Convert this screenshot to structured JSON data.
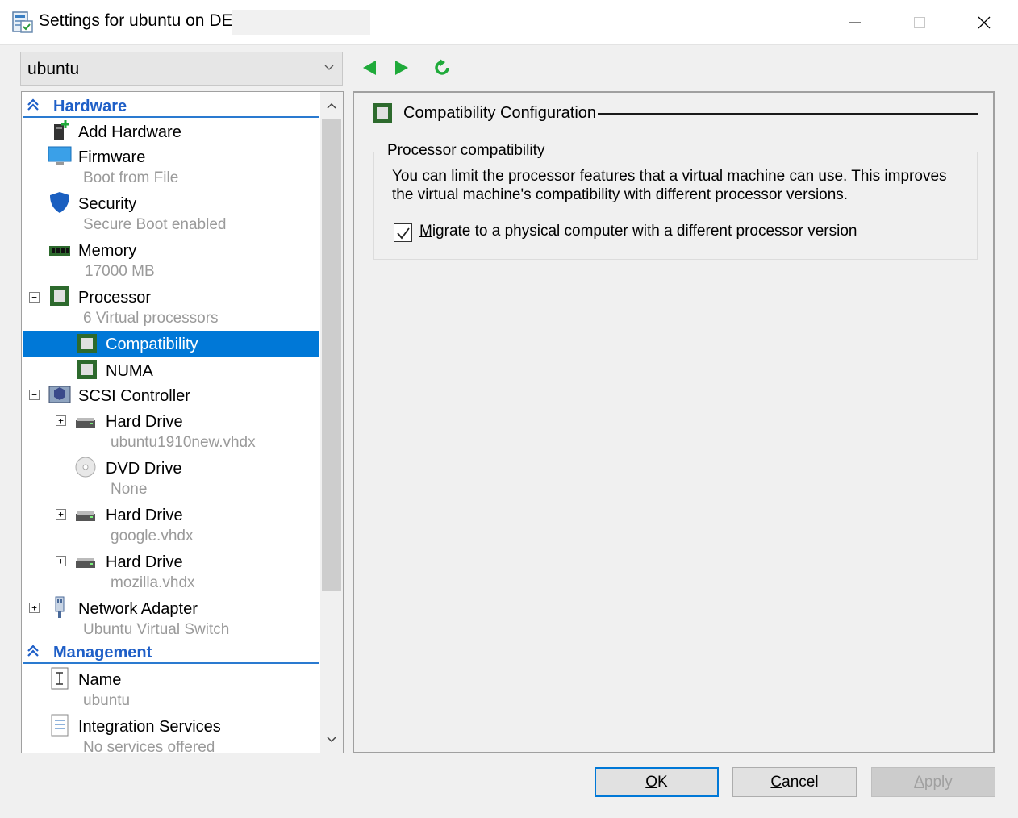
{
  "window": {
    "title": "Settings for ubuntu on DE",
    "minimize_icon": "minimize-icon",
    "maximize_icon": "maximize-icon",
    "close_icon": "close-icon"
  },
  "vm_selector": {
    "value": "ubuntu"
  },
  "toolbar": {
    "prev_icon": "arrow-left-icon",
    "next_icon": "arrow-right-icon",
    "refresh_icon": "refresh-icon"
  },
  "tree": {
    "hardware_header": "Hardware",
    "management_header": "Management",
    "items": {
      "add_hardware": {
        "label": "Add Hardware"
      },
      "firmware": {
        "label": "Firmware",
        "sub": "Boot from File"
      },
      "security": {
        "label": "Security",
        "sub": "Secure Boot enabled"
      },
      "memory": {
        "label": "Memory",
        "sub": "17000 MB"
      },
      "processor": {
        "label": "Processor",
        "sub": "6 Virtual processors"
      },
      "compatibility": {
        "label": "Compatibility"
      },
      "numa": {
        "label": "NUMA"
      },
      "scsi": {
        "label": "SCSI Controller"
      },
      "hdd1": {
        "label": "Hard Drive",
        "sub": "ubuntu1910new.vhdx"
      },
      "dvd": {
        "label": "DVD Drive",
        "sub": "None"
      },
      "hdd2": {
        "label": "Hard Drive",
        "sub": "google.vhdx"
      },
      "hdd3": {
        "label": "Hard Drive",
        "sub": "mozilla.vhdx"
      },
      "network": {
        "label": "Network Adapter",
        "sub": "Ubuntu Virtual Switch"
      },
      "name": {
        "label": "Name",
        "sub": "ubuntu"
      },
      "integration": {
        "label": "Integration Services",
        "sub": "No services offered"
      }
    }
  },
  "panel": {
    "title": "Compatibility Configuration",
    "group_title": "Processor compatibility",
    "desc_line1": "You can limit the processor features that a virtual machine can use. This improves",
    "desc_line2": "the virtual machine's compatibility with different processor versions.",
    "checkbox_label": "Migrate to a physical computer with a different processor version",
    "checkbox_checked": true
  },
  "buttons": {
    "ok": "OK",
    "cancel": "Cancel",
    "apply": "Apply"
  },
  "colors": {
    "selection": "#0078d7",
    "header": "#1f5fc7",
    "arrow_green": "#1faa3a"
  }
}
